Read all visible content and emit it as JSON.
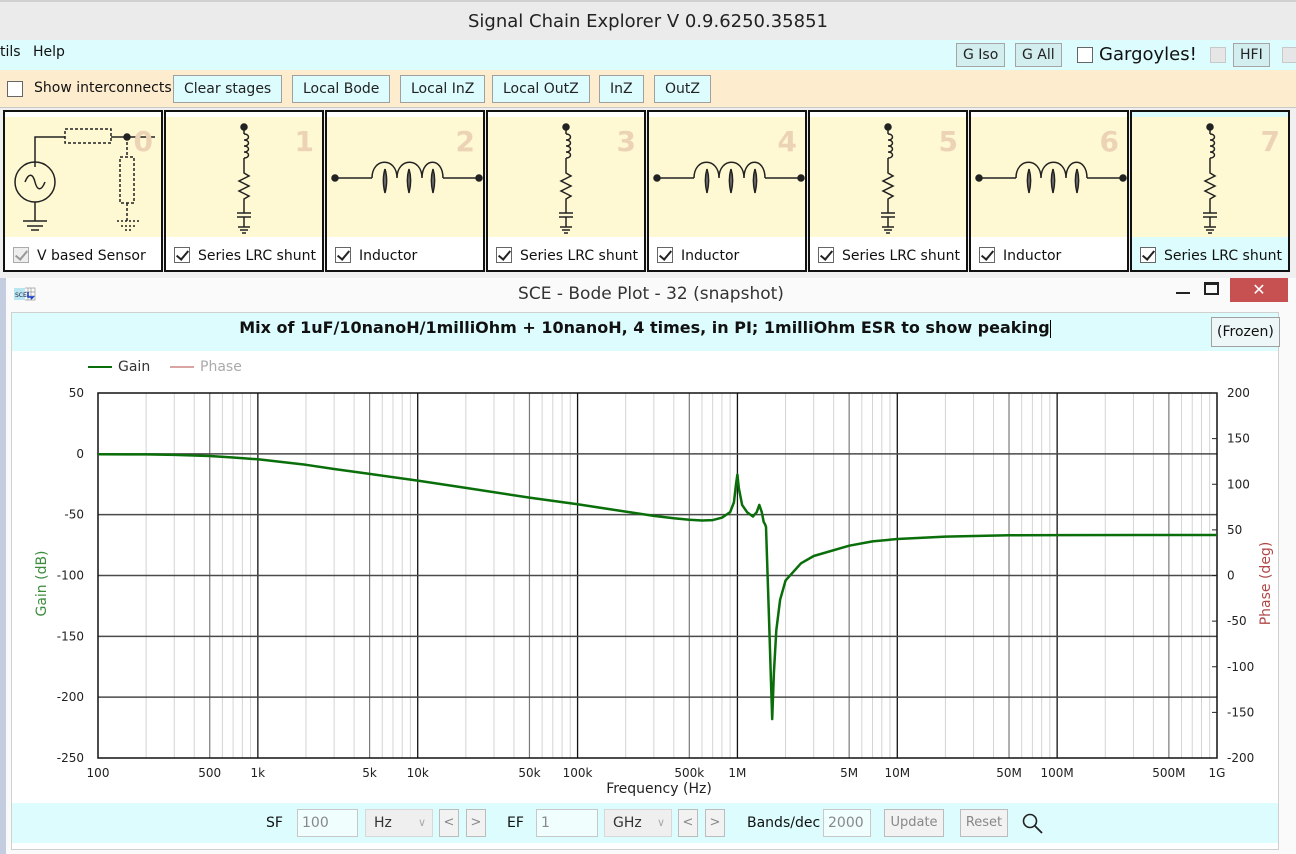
{
  "app": {
    "title": "Signal Chain Explorer V 0.9.6250.35851"
  },
  "menu": {
    "items": [
      "tils",
      "Help"
    ],
    "right_buttons": [
      "G Iso",
      "G All",
      "HFI"
    ],
    "gargoyles_label": "Gargoyles!",
    "gargoyles_checked": false
  },
  "toolbar": {
    "show_interconnects_label": "Show interconnects",
    "show_interconnects_checked": false,
    "buttons": [
      "Clear stages",
      "Local Bode",
      "Local InZ",
      "Local OutZ",
      "InZ",
      "OutZ"
    ]
  },
  "stages": [
    {
      "index": "0",
      "label": "V based Sensor",
      "checked": true,
      "type": "source"
    },
    {
      "index": "1",
      "label": "Series LRC shunt",
      "checked": true,
      "type": "lrc"
    },
    {
      "index": "2",
      "label": "Inductor",
      "checked": true,
      "type": "inductor"
    },
    {
      "index": "3",
      "label": "Series LRC shunt",
      "checked": true,
      "type": "lrc"
    },
    {
      "index": "4",
      "label": "Inductor",
      "checked": true,
      "type": "inductor"
    },
    {
      "index": "5",
      "label": "Series LRC shunt",
      "checked": true,
      "type": "lrc"
    },
    {
      "index": "6",
      "label": "Inductor",
      "checked": true,
      "type": "inductor"
    },
    {
      "index": "7",
      "label": "Series LRC shunt",
      "checked": true,
      "type": "lrc",
      "selected": true
    }
  ],
  "bode_window": {
    "title": "SCE - Bode Plot - 32  (snapshot)",
    "app_icon": "sce-icon",
    "description": "Mix of 1uF/10nanoH/1milliOhm + 10nanoH, 4 times, in PI; 1milliOhm ESR to show peaking",
    "frozen_label": "(Frozen)",
    "controls": {
      "minimize": "minimize-icon",
      "maximize": "maximize-icon",
      "close": "✕"
    }
  },
  "footer": {
    "sf_label": "SF",
    "sf_value": "100",
    "sf_unit": "Hz",
    "ef_label": "EF",
    "ef_value": "1",
    "ef_unit": "GHz",
    "prev_label": "<",
    "next_label": ">",
    "bands_label": "Bands/dec",
    "bands_value": "2000",
    "update_label": "Update",
    "reset_label": "Reset",
    "zoom_icon": "magnifier-icon"
  },
  "colors": {
    "gain": "#0a6e0a",
    "phase": "#d9a4a4",
    "phase_axis": "#b04848",
    "gain_axis": "#3c8c3c"
  },
  "chart_data": {
    "type": "line",
    "title": "",
    "xlabel": "Frequency (Hz)",
    "ylabel": "Gain (dB)",
    "y2label": "Phase (deg)",
    "xscale": "log",
    "xlim": [
      100,
      1000000000
    ],
    "ylim": [
      -250,
      50
    ],
    "y2lim": [
      -200,
      200
    ],
    "x_ticks": [
      {
        "v": 100,
        "t": "100"
      },
      {
        "v": 500,
        "t": "500"
      },
      {
        "v": 1000,
        "t": "1k"
      },
      {
        "v": 5000,
        "t": "5k"
      },
      {
        "v": 10000,
        "t": "10k"
      },
      {
        "v": 50000,
        "t": "50k"
      },
      {
        "v": 100000,
        "t": "100k"
      },
      {
        "v": 500000,
        "t": "500k"
      },
      {
        "v": 1000000,
        "t": "1M"
      },
      {
        "v": 5000000,
        "t": "5M"
      },
      {
        "v": 10000000,
        "t": "10M"
      },
      {
        "v": 50000000,
        "t": "50M"
      },
      {
        "v": 100000000,
        "t": "100M"
      },
      {
        "v": 500000000,
        "t": "500M"
      },
      {
        "v": 1000000000,
        "t": "1G"
      }
    ],
    "y_ticks": [
      50,
      0,
      -50,
      -100,
      -150,
      -200,
      -250
    ],
    "y2_ticks": [
      200,
      150,
      100,
      50,
      0,
      -50,
      -100,
      -150,
      -200
    ],
    "grid": true,
    "legend": {
      "position": "top-left",
      "entries": [
        "Gain",
        "Phase"
      ]
    },
    "series": [
      {
        "name": "Gain",
        "visible": true,
        "points": [
          [
            100,
            -0.3
          ],
          [
            200,
            -0.5
          ],
          [
            300,
            -0.9
          ],
          [
            500,
            -1.8
          ],
          [
            700,
            -3.0
          ],
          [
            1000,
            -4.5
          ],
          [
            2000,
            -9
          ],
          [
            3000,
            -12.5
          ],
          [
            5000,
            -16.5
          ],
          [
            10000,
            -22
          ],
          [
            20000,
            -28
          ],
          [
            50000,
            -36
          ],
          [
            100000,
            -41.5
          ],
          [
            200000,
            -47.5
          ],
          [
            300000,
            -51
          ],
          [
            400000,
            -53
          ],
          [
            500000,
            -54.2
          ],
          [
            600000,
            -54.8
          ],
          [
            700000,
            -54.5
          ],
          [
            800000,
            -52.5
          ],
          [
            900000,
            -48
          ],
          [
            950000,
            -40
          ],
          [
            980000,
            -25
          ],
          [
            1000000,
            -17
          ],
          [
            1020000,
            -28
          ],
          [
            1070000,
            -42
          ],
          [
            1150000,
            -48
          ],
          [
            1250000,
            -51.5
          ],
          [
            1320000,
            -48
          ],
          [
            1370000,
            -42
          ],
          [
            1420000,
            -48
          ],
          [
            1460000,
            -56
          ],
          [
            1490000,
            -58
          ],
          [
            1510000,
            -60
          ],
          [
            1540000,
            -95
          ],
          [
            1580000,
            -140
          ],
          [
            1620000,
            -185
          ],
          [
            1650000,
            -218
          ],
          [
            1690000,
            -180
          ],
          [
            1750000,
            -145
          ],
          [
            1850000,
            -120
          ],
          [
            2000000,
            -104
          ],
          [
            2500000,
            -90
          ],
          [
            3000000,
            -84
          ],
          [
            5000000,
            -75.5
          ],
          [
            7000000,
            -72
          ],
          [
            10000000,
            -70
          ],
          [
            20000000,
            -68
          ],
          [
            50000000,
            -67
          ],
          [
            100000000,
            -66.8
          ],
          [
            1000000000,
            -66.7
          ]
        ]
      },
      {
        "name": "Phase",
        "visible": false,
        "points": []
      }
    ]
  }
}
